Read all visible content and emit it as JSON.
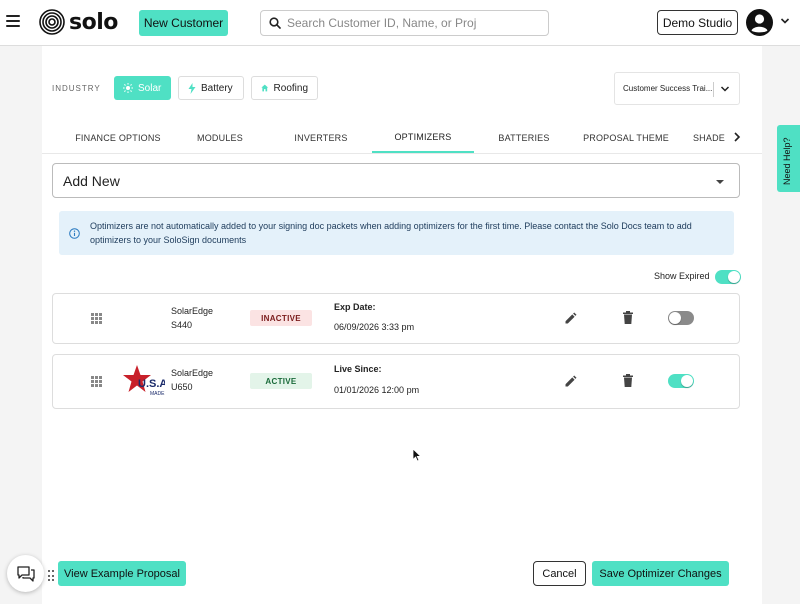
{
  "header": {
    "logo_text": "solo",
    "new_customer_label": "New Customer",
    "search_placeholder": "Search Customer ID, Name, or Proj",
    "studio_label": "Demo Studio"
  },
  "industry": {
    "label": "INDUSTRY",
    "chips": [
      {
        "label": "Solar",
        "selected": true
      },
      {
        "label": "Battery",
        "selected": false
      },
      {
        "label": "Roofing",
        "selected": false
      }
    ]
  },
  "proposal_select": {
    "value": "Customer Success Trai..."
  },
  "tabs": [
    {
      "label": "FINANCE OPTIONS",
      "active": false
    },
    {
      "label": "MODULES",
      "active": false
    },
    {
      "label": "INVERTERS",
      "active": false
    },
    {
      "label": "OPTIMIZERS",
      "active": true
    },
    {
      "label": "BATTERIES",
      "active": false
    },
    {
      "label": "PROPOSAL THEME",
      "active": false
    },
    {
      "label": "SHADE",
      "active": false
    }
  ],
  "need_help_label": "Need Help?",
  "add_new_label": "Add New",
  "info_text": "Optimizers are not automatically added to your signing doc packets when adding optimizers for the first time. Please contact the Solo Docs team to add optimizers to your SoloSign documents",
  "show_expired": {
    "label": "Show Expired",
    "on": true
  },
  "optimizers": [
    {
      "manufacturer": "SolarEdge",
      "model": "S440",
      "status": "INACTIVE",
      "date_label": "Exp Date:",
      "date_value": "06/09/2026 3:33 pm",
      "enabled": false,
      "badge": ""
    },
    {
      "manufacturer": "SolarEdge",
      "model": "U650",
      "status": "ACTIVE",
      "date_label": "Live Since:",
      "date_value": "01/01/2026 12:00 pm",
      "enabled": true,
      "badge": "U.S.A. MADE"
    }
  ],
  "footer": {
    "view_example_label": "View Example Proposal",
    "cancel_label": "Cancel",
    "save_label": "Save Optimizer Changes"
  },
  "colors": {
    "accent": "#4fe0c4",
    "info_bg": "#e4f1fa",
    "inactive_bg": "#fbe3e3",
    "active_bg": "#e3f4e9"
  }
}
